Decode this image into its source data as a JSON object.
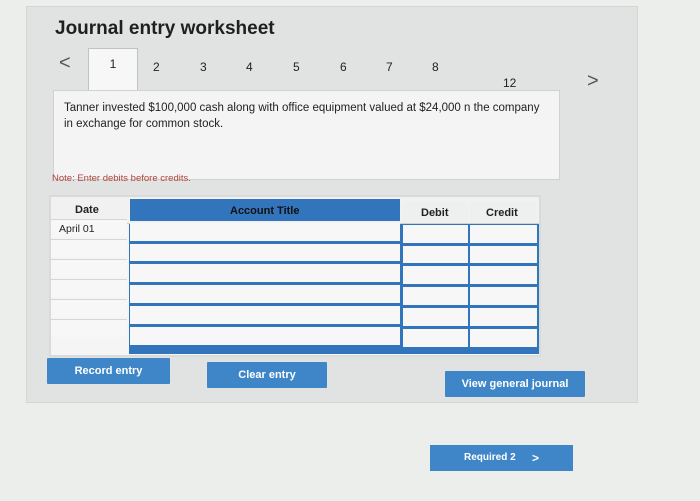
{
  "worksheet": {
    "title": "Journal entry worksheet",
    "tabs": [
      "1",
      "2",
      "3",
      "4",
      "5",
      "6",
      "7",
      "8",
      "12"
    ],
    "active_tab": "1",
    "prev_arrow": "<",
    "next_arrow": ">"
  },
  "transaction": {
    "description": "Tanner invested $100,000 cash along with office equipment valued at $24,000 n the company in exchange for common stock."
  },
  "note": "Note: Enter debits before credits.",
  "table": {
    "headers": {
      "date": "Date",
      "account": "Account Title",
      "debit": "Debit",
      "credit": "Credit"
    },
    "rows": [
      {
        "date": "April 01",
        "account": "",
        "debit": "",
        "credit": ""
      },
      {
        "date": "",
        "account": "",
        "debit": "",
        "credit": ""
      },
      {
        "date": "",
        "account": "",
        "debit": "",
        "credit": ""
      },
      {
        "date": "",
        "account": "",
        "debit": "",
        "credit": ""
      },
      {
        "date": "",
        "account": "",
        "debit": "",
        "credit": ""
      },
      {
        "date": "",
        "account": "",
        "debit": "",
        "credit": ""
      }
    ]
  },
  "buttons": {
    "record": "Record entry",
    "clear": "Clear entry",
    "view_journal": "View general journal",
    "required": "Required 2",
    "required_arrow": ">"
  },
  "colors": {
    "accent": "#3f86c8",
    "table_blue": "#3275bd",
    "note_red": "#b0433a"
  }
}
